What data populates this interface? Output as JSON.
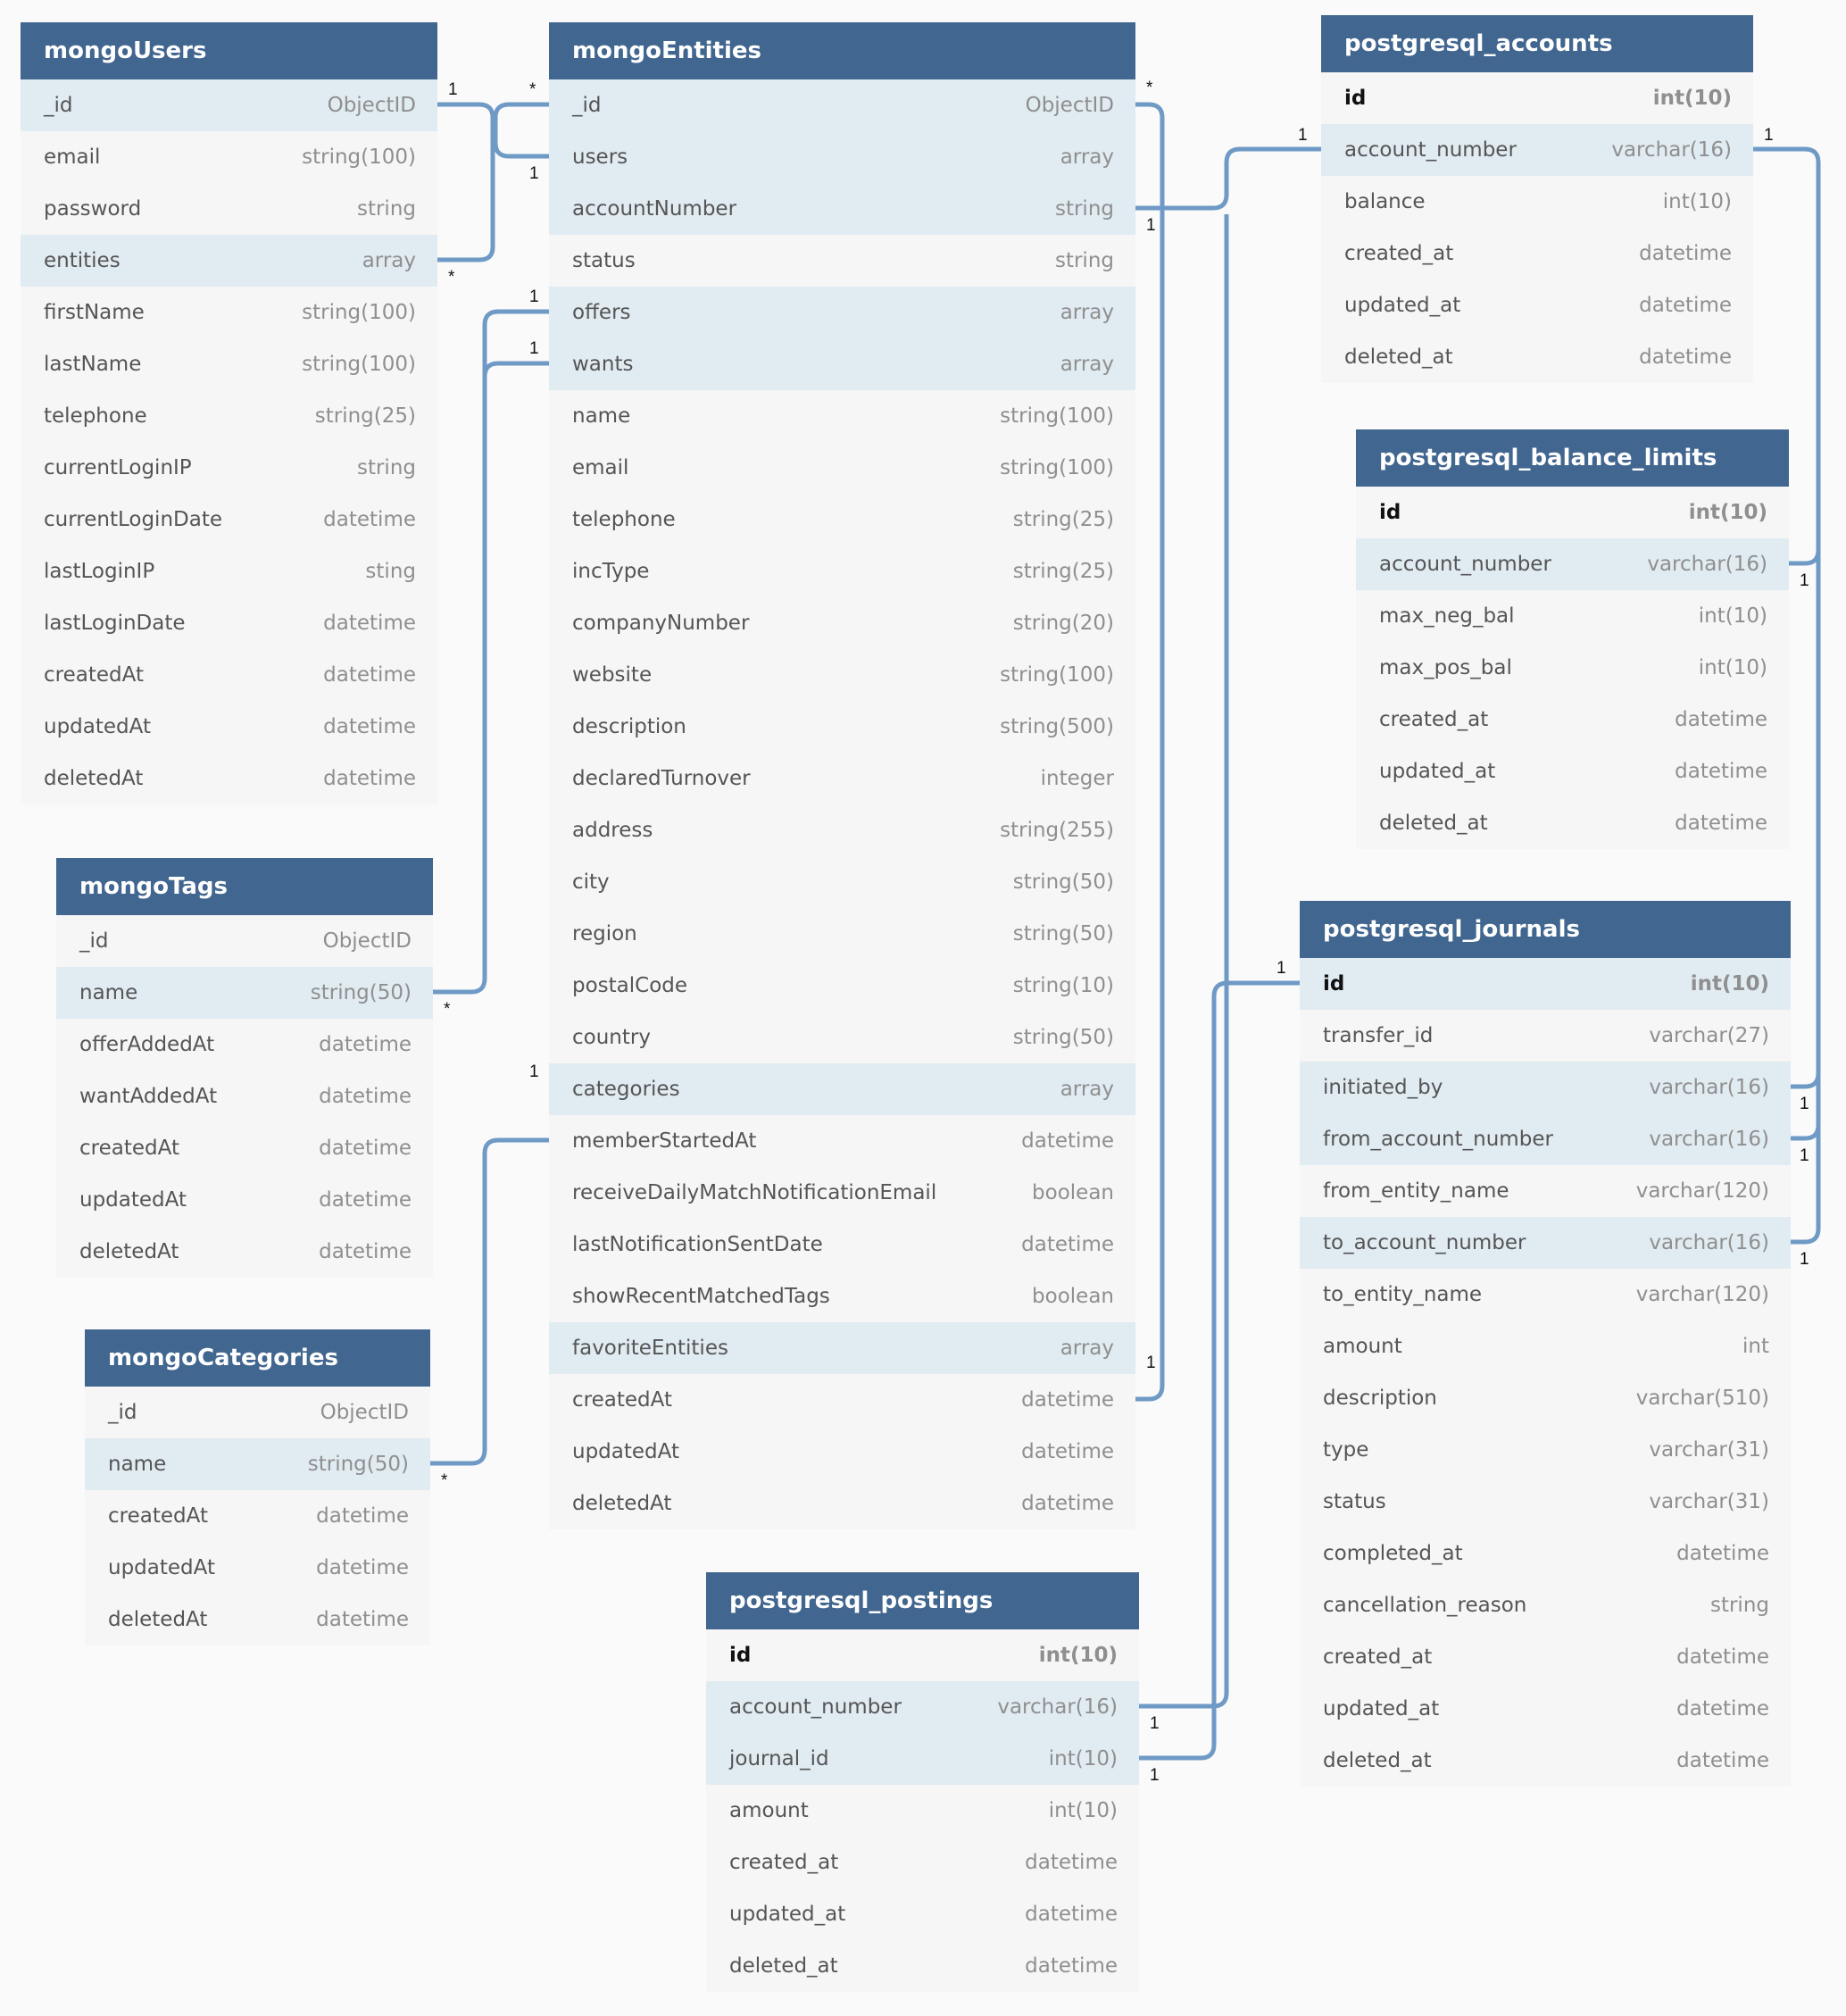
{
  "diagram_title": "",
  "colors": {
    "header": "#41668f",
    "highlight_row": "#e1ebf2",
    "row": "#f6f6f6",
    "link": "#6f9ac6",
    "background": "#fafafa"
  },
  "tables": {
    "mongoUsers": {
      "name": "mongoUsers",
      "fields": [
        {
          "name": "_id",
          "type": "ObjectID",
          "hl": true
        },
        {
          "name": "email",
          "type": "string(100)"
        },
        {
          "name": "password",
          "type": "string"
        },
        {
          "name": "entities",
          "type": "array",
          "hl": true
        },
        {
          "name": "firstName",
          "type": "string(100)"
        },
        {
          "name": "lastName",
          "type": "string(100)"
        },
        {
          "name": "telephone",
          "type": "string(25)"
        },
        {
          "name": "currentLoginIP",
          "type": "string"
        },
        {
          "name": "currentLoginDate",
          "type": "datetime"
        },
        {
          "name": "lastLoginIP",
          "type": "sting"
        },
        {
          "name": "lastLoginDate",
          "type": "datetime"
        },
        {
          "name": "createdAt",
          "type": "datetime"
        },
        {
          "name": "updatedAt",
          "type": "datetime"
        },
        {
          "name": "deletedAt",
          "type": "datetime"
        }
      ]
    },
    "mongoEntities": {
      "name": "mongoEntities",
      "fields": [
        {
          "name": "_id",
          "type": "ObjectID",
          "hl": true
        },
        {
          "name": "users",
          "type": "array",
          "hl": true
        },
        {
          "name": "accountNumber",
          "type": "string",
          "hl": true
        },
        {
          "name": "status",
          "type": "string"
        },
        {
          "name": "offers",
          "type": "array",
          "hl": true
        },
        {
          "name": "wants",
          "type": "array",
          "hl": true
        },
        {
          "name": "name",
          "type": "string(100)"
        },
        {
          "name": "email",
          "type": "string(100)"
        },
        {
          "name": "telephone",
          "type": "string(25)"
        },
        {
          "name": "incType",
          "type": "string(25)"
        },
        {
          "name": "companyNumber",
          "type": "string(20)"
        },
        {
          "name": "website",
          "type": "string(100)"
        },
        {
          "name": "description",
          "type": "string(500)"
        },
        {
          "name": "declaredTurnover",
          "type": "integer"
        },
        {
          "name": "address",
          "type": "string(255)"
        },
        {
          "name": "city",
          "type": "string(50)"
        },
        {
          "name": "region",
          "type": "string(50)"
        },
        {
          "name": "postalCode",
          "type": "string(10)"
        },
        {
          "name": "country",
          "type": "string(50)"
        },
        {
          "name": "categories",
          "type": "array",
          "hl": true
        },
        {
          "name": "memberStartedAt",
          "type": "datetime"
        },
        {
          "name": "receiveDailyMatchNotificationEmail",
          "type": "boolean"
        },
        {
          "name": "lastNotificationSentDate",
          "type": "datetime"
        },
        {
          "name": "showRecentMatchedTags",
          "type": "boolean"
        },
        {
          "name": "favoriteEntities",
          "type": "array",
          "hl": true
        },
        {
          "name": "createdAt",
          "type": "datetime"
        },
        {
          "name": "updatedAt",
          "type": "datetime"
        },
        {
          "name": "deletedAt",
          "type": "datetime"
        }
      ]
    },
    "mongoTags": {
      "name": "mongoTags",
      "fields": [
        {
          "name": "_id",
          "type": "ObjectID"
        },
        {
          "name": "name",
          "type": "string(50)",
          "hl": true
        },
        {
          "name": "offerAddedAt",
          "type": "datetime"
        },
        {
          "name": "wantAddedAt",
          "type": "datetime"
        },
        {
          "name": "createdAt",
          "type": "datetime"
        },
        {
          "name": "updatedAt",
          "type": "datetime"
        },
        {
          "name": "deletedAt",
          "type": "datetime"
        }
      ]
    },
    "mongoCategories": {
      "name": "mongoCategories",
      "fields": [
        {
          "name": "_id",
          "type": "ObjectID"
        },
        {
          "name": "name",
          "type": "string(50)",
          "hl": true
        },
        {
          "name": "createdAt",
          "type": "datetime"
        },
        {
          "name": "updatedAt",
          "type": "datetime"
        },
        {
          "name": "deletedAt",
          "type": "datetime"
        }
      ]
    },
    "postgresql_accounts": {
      "name": "postgresql_accounts",
      "fields": [
        {
          "name": "id",
          "type": "int(10)",
          "pk": true
        },
        {
          "name": "account_number",
          "type": "varchar(16)",
          "hl": true
        },
        {
          "name": "balance",
          "type": "int(10)"
        },
        {
          "name": "created_at",
          "type": "datetime"
        },
        {
          "name": "updated_at",
          "type": "datetime"
        },
        {
          "name": "deleted_at",
          "type": "datetime"
        }
      ]
    },
    "postgresql_balance_limits": {
      "name": "postgresql_balance_limits",
      "fields": [
        {
          "name": "id",
          "type": "int(10)",
          "pk": true
        },
        {
          "name": "account_number",
          "type": "varchar(16)",
          "hl": true
        },
        {
          "name": "max_neg_bal",
          "type": "int(10)"
        },
        {
          "name": "max_pos_bal",
          "type": "int(10)"
        },
        {
          "name": "created_at",
          "type": "datetime"
        },
        {
          "name": "updated_at",
          "type": "datetime"
        },
        {
          "name": "deleted_at",
          "type": "datetime"
        }
      ]
    },
    "postgresql_journals": {
      "name": "postgresql_journals",
      "fields": [
        {
          "name": "id",
          "type": "int(10)",
          "pk": true,
          "hl": true
        },
        {
          "name": "transfer_id",
          "type": "varchar(27)"
        },
        {
          "name": "initiated_by",
          "type": "varchar(16)",
          "hl": true
        },
        {
          "name": "from_account_number",
          "type": "varchar(16)",
          "hl": true
        },
        {
          "name": "from_entity_name",
          "type": "varchar(120)"
        },
        {
          "name": "to_account_number",
          "type": "varchar(16)",
          "hl": true
        },
        {
          "name": "to_entity_name",
          "type": "varchar(120)"
        },
        {
          "name": "amount",
          "type": "int"
        },
        {
          "name": "description",
          "type": "varchar(510)"
        },
        {
          "name": "type",
          "type": "varchar(31)"
        },
        {
          "name": "status",
          "type": "varchar(31)"
        },
        {
          "name": "completed_at",
          "type": "datetime"
        },
        {
          "name": "cancellation_reason",
          "type": "string"
        },
        {
          "name": "created_at",
          "type": "datetime"
        },
        {
          "name": "updated_at",
          "type": "datetime"
        },
        {
          "name": "deleted_at",
          "type": "datetime"
        }
      ]
    },
    "postgresql_postings": {
      "name": "postgresql_postings",
      "fields": [
        {
          "name": "id",
          "type": "int(10)",
          "pk": true
        },
        {
          "name": "account_number",
          "type": "varchar(16)",
          "hl": true
        },
        {
          "name": "journal_id",
          "type": "int(10)",
          "hl": true
        },
        {
          "name": "amount",
          "type": "int(10)"
        },
        {
          "name": "created_at",
          "type": "datetime"
        },
        {
          "name": "updated_at",
          "type": "datetime"
        },
        {
          "name": "deleted_at",
          "type": "datetime"
        }
      ]
    }
  },
  "relationships": [
    {
      "from": "mongoUsers._id",
      "to": "mongoEntities.users",
      "from_card": "1",
      "to_card": "*"
    },
    {
      "from": "mongoUsers.entities",
      "to": "mongoEntities._id",
      "from_card": "*",
      "to_card": "1"
    },
    {
      "from": "mongoTags.name",
      "to": "mongoEntities.offers",
      "from_card": "*",
      "to_card": "1"
    },
    {
      "from": "mongoTags.name",
      "to": "mongoEntities.wants",
      "from_card": "*",
      "to_card": "1"
    },
    {
      "from": "mongoCategories.name",
      "to": "mongoEntities.categories",
      "from_card": "*",
      "to_card": "1"
    },
    {
      "from": "mongoEntities._id",
      "to": "mongoEntities.favoriteEntities",
      "from_card": "*",
      "to_card": "1"
    },
    {
      "from": "mongoEntities.accountNumber",
      "to": "postgresql_accounts.account_number",
      "from_card": "1",
      "to_card": "1"
    },
    {
      "from": "postgresql_accounts.account_number",
      "to": "postgresql_balance_limits.account_number",
      "from_card": "1",
      "to_card": "1"
    },
    {
      "from": "postgresql_accounts.account_number",
      "to": "postgresql_journals.initiated_by",
      "from_card": "1",
      "to_card": "1"
    },
    {
      "from": "postgresql_accounts.account_number",
      "to": "postgresql_journals.from_account_number",
      "from_card": "1",
      "to_card": "1"
    },
    {
      "from": "postgresql_accounts.account_number",
      "to": "postgresql_journals.to_account_number",
      "from_card": "1",
      "to_card": "1"
    },
    {
      "from": "postgresql_postings.account_number",
      "to": "postgresql_accounts.account_number",
      "from_card": "1",
      "to_card": "1"
    },
    {
      "from": "postgresql_postings.journal_id",
      "to": "postgresql_journals.id",
      "from_card": "1",
      "to_card": "1"
    }
  ]
}
